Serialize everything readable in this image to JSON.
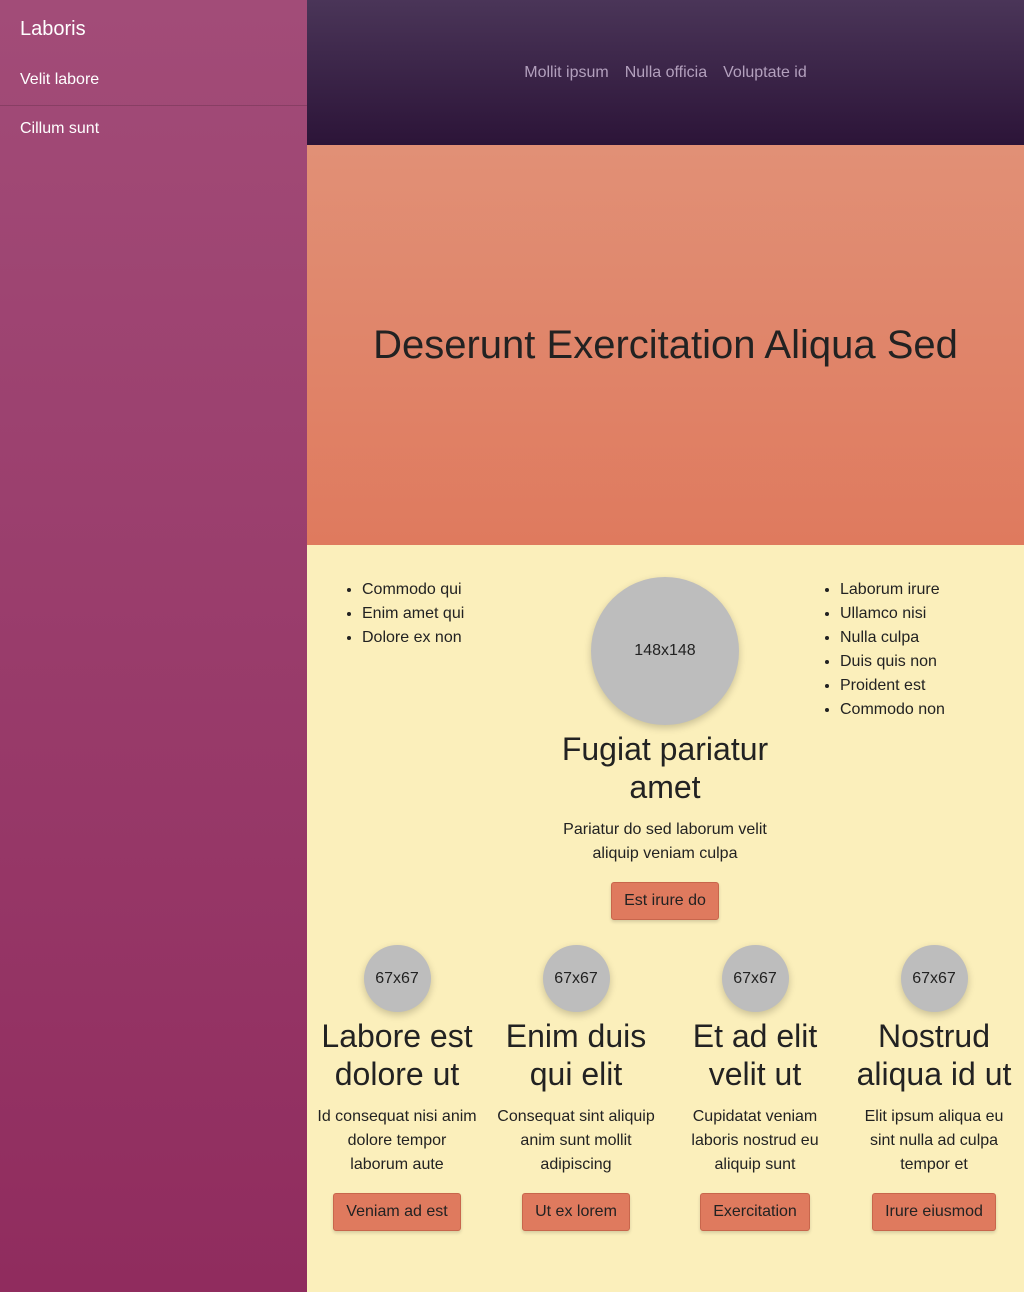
{
  "sidebar": {
    "brand": "Laboris",
    "items": [
      {
        "label": "Velit labore"
      },
      {
        "label": "Cillum sunt"
      }
    ]
  },
  "topnav": {
    "items": [
      {
        "label": "Mollit ipsum"
      },
      {
        "label": "Nulla officia"
      },
      {
        "label": "Voluptate id"
      }
    ]
  },
  "hero": {
    "title": "Deserunt Exercitation Aliqua Sed"
  },
  "content": {
    "left_list": [
      "Commodo qui",
      "Enim amet qui",
      "Dolore ex non"
    ],
    "right_list": [
      "Laborum irure",
      "Ullamco nisi",
      "Nulla culpa",
      "Duis quis non",
      "Proident est",
      "Commodo non"
    ],
    "main_feature": {
      "image_label": "148x148",
      "title": "Fugiat pariatur amet",
      "text": "Pariatur do sed laborum velit aliquip veniam culpa",
      "button": "Est irure do"
    },
    "features": [
      {
        "image_label": "67x67",
        "title": "Labore est dolore ut",
        "text": "Id consequat nisi anim dolore tempor laborum aute",
        "button": "Veniam ad est"
      },
      {
        "image_label": "67x67",
        "title": "Enim duis qui elit",
        "text": "Consequat sint aliquip anim sunt mollit adipiscing",
        "button": "Ut ex lorem"
      },
      {
        "image_label": "67x67",
        "title": "Et ad elit velit ut",
        "text": "Cupidatat veniam laboris nostrud eu aliquip sunt",
        "button": "Exercitation"
      },
      {
        "image_label": "67x67",
        "title": "Nostrud aliqua id ut",
        "text": "Elit ipsum aliqua eu sint nulla ad culpa tempor et",
        "button": "Irure eiusmod"
      }
    ]
  }
}
